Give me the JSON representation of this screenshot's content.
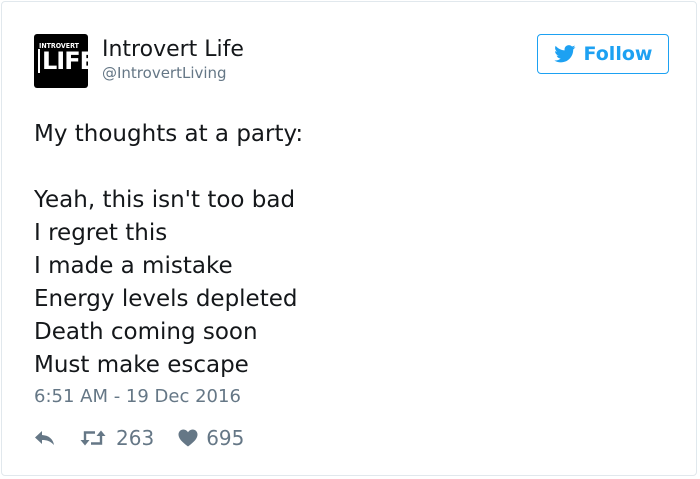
{
  "account": {
    "avatar_text_small": "INTROVERT",
    "avatar_text_big": "LIFE",
    "display_name": "Introvert Life",
    "handle": "@IntrovertLiving"
  },
  "follow_button": {
    "label": "Follow",
    "icon": "twitter-bird-icon",
    "color": "#1da1f2"
  },
  "tweet": {
    "lines": [
      "My thoughts at a party:",
      "",
      "Yeah, this isn't too bad",
      "I regret this",
      "I made a mistake",
      "Energy levels depleted",
      "Death coming soon",
      "Must make escape"
    ],
    "timestamp": "6:51 AM - 19 Dec 2016"
  },
  "actions": {
    "reply_icon": "reply-arrow-icon",
    "retweet_icon": "retweet-icon",
    "retweet_count": "263",
    "like_icon": "heart-icon",
    "like_count": "695"
  },
  "colors": {
    "text": "#14171a",
    "secondary": "#657786",
    "border": "#e1e8ed"
  }
}
